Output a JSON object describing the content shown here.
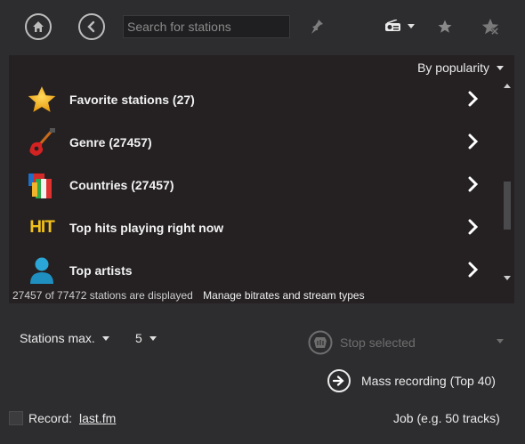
{
  "toolbar": {
    "search_placeholder": "Search for stations",
    "icons": [
      "home-icon",
      "back-icon",
      "pin-icon",
      "radio-icon",
      "star-icon",
      "star-remove-icon"
    ]
  },
  "panel": {
    "sort_label": "By popularity",
    "items": [
      {
        "label": "Favorite stations (27)",
        "icon": "star-icon"
      },
      {
        "label": "Genre (27457)",
        "icon": "guitar-icon"
      },
      {
        "label": "Countries (27457)",
        "icon": "flags-icon"
      },
      {
        "label": "Top hits playing right now",
        "icon": "hit-icon",
        "icon_text": "HIT"
      },
      {
        "label": "Top artists",
        "icon": "user-icon"
      }
    ],
    "status_text": "27457 of 77472 stations are displayed",
    "manage_label": "Manage bitrates and stream types"
  },
  "bottom": {
    "stations_max_label": "Stations max.",
    "stations_max_value": "5",
    "stop_selected_label": "Stop selected",
    "mass_recording_label": "Mass recording (Top 40)",
    "record_label": "Record:",
    "record_link": "last.fm",
    "job_label": "Job (e.g. 50 tracks)"
  },
  "colors": {
    "background": "#2d2d30",
    "panel": "#252122",
    "star": "#f6b21a",
    "hit": "#f2c21a",
    "user": "#2aa7d6"
  }
}
